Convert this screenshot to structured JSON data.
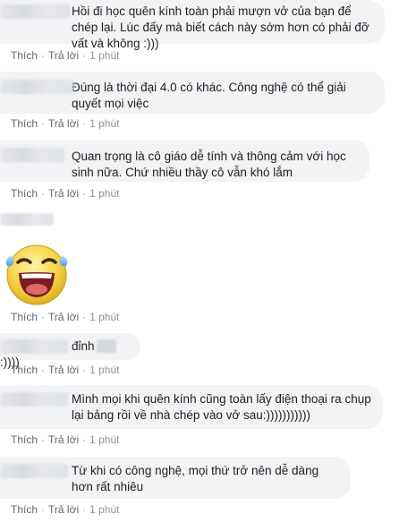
{
  "comments": [
    {
      "text": "Hồi đi học quên kính toàn phải mượn vở của bạn để chép lại. Lúc đấy mà biết cách này sớm hơn có phải đỡ vất và không :)))",
      "like": "Thích",
      "reply": "Trả lời",
      "time": "1 phút"
    },
    {
      "text": "Đúng là thời đại 4.0 có khác. Công nghệ có thể giải quyết mọi việc",
      "like": "Thích",
      "reply": "Trả lời",
      "time": "1 phút"
    },
    {
      "text": "Quan trọng là cô giáo dễ tính và thông cảm với học sinh nữa. Chứ nhiều thầy cô vẫn khó lắm",
      "like": "Thích",
      "reply": "Trả lời",
      "time": "1 phút"
    },
    {
      "sticker": "laughing-tears-sticker",
      "like": "Thích",
      "reply": "Trả lời",
      "time": "1 phút"
    },
    {
      "text_before": "đỉnh",
      "text_after": ":))))",
      "like": "Thích",
      "reply": "Trả lời",
      "time": "1 phút"
    },
    {
      "text": "Mình mọi khi quên kính cũng toàn lấy điện thoại ra chụp lại bảng rồi về nhà chép vào vở sau:)))))))))))",
      "like": "Thích",
      "reply": "Trả lời",
      "time": "1 phút"
    },
    {
      "text": "Từ khi có công nghệ, mọi thứ trở nên dễ dàng hơn rất nhiêu",
      "like": "Thích",
      "reply": "Trả lời",
      "time": "1 phút"
    }
  ],
  "colors": {
    "bubble": "#f2f3f5",
    "action_text": "#606770",
    "body_text": "#1c1e21"
  }
}
